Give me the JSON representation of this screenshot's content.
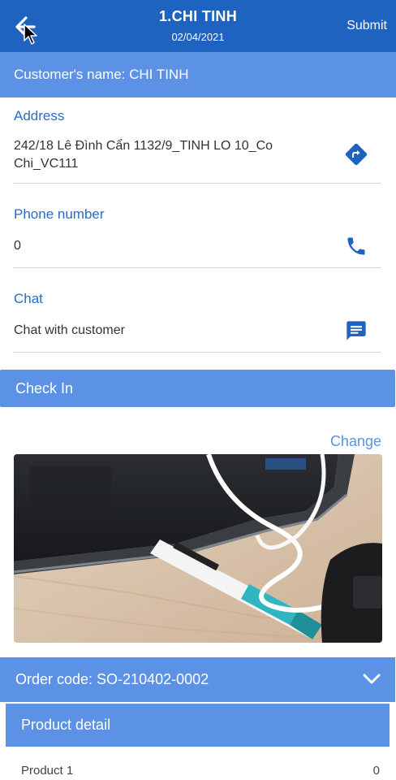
{
  "header": {
    "title": "1.CHI TINH",
    "date": "02/04/2021",
    "submit_label": "Submit"
  },
  "customer": {
    "name_line": "Customer's name: CHI TINH"
  },
  "address": {
    "label": "Address",
    "line1": "242/18 Lê Đình Cẩn 1132/9_TINH LO 10_Co",
    "line2": "Chi_VC111"
  },
  "phone": {
    "label": "Phone number",
    "value": "0"
  },
  "chat": {
    "label": "Chat",
    "value": "Chat with customer"
  },
  "checkin": {
    "label": "Check In",
    "change_label": "Change"
  },
  "order": {
    "label": "Order code:  SO-210402-0002"
  },
  "product_detail": {
    "title": "Product detail",
    "rows": [
      {
        "name": "Product 1",
        "qty": "0"
      }
    ]
  },
  "colors": {
    "appbar": "#1e63c0",
    "section_bar": "#5b92e5",
    "label_blue": "#2b6cc4",
    "icon_blue": "#1e63c0"
  },
  "icons": {
    "back": "arrow-left-icon",
    "directions": "directions-icon",
    "phone": "phone-icon",
    "chat": "chat-icon",
    "chevron": "chevron-down-icon"
  }
}
